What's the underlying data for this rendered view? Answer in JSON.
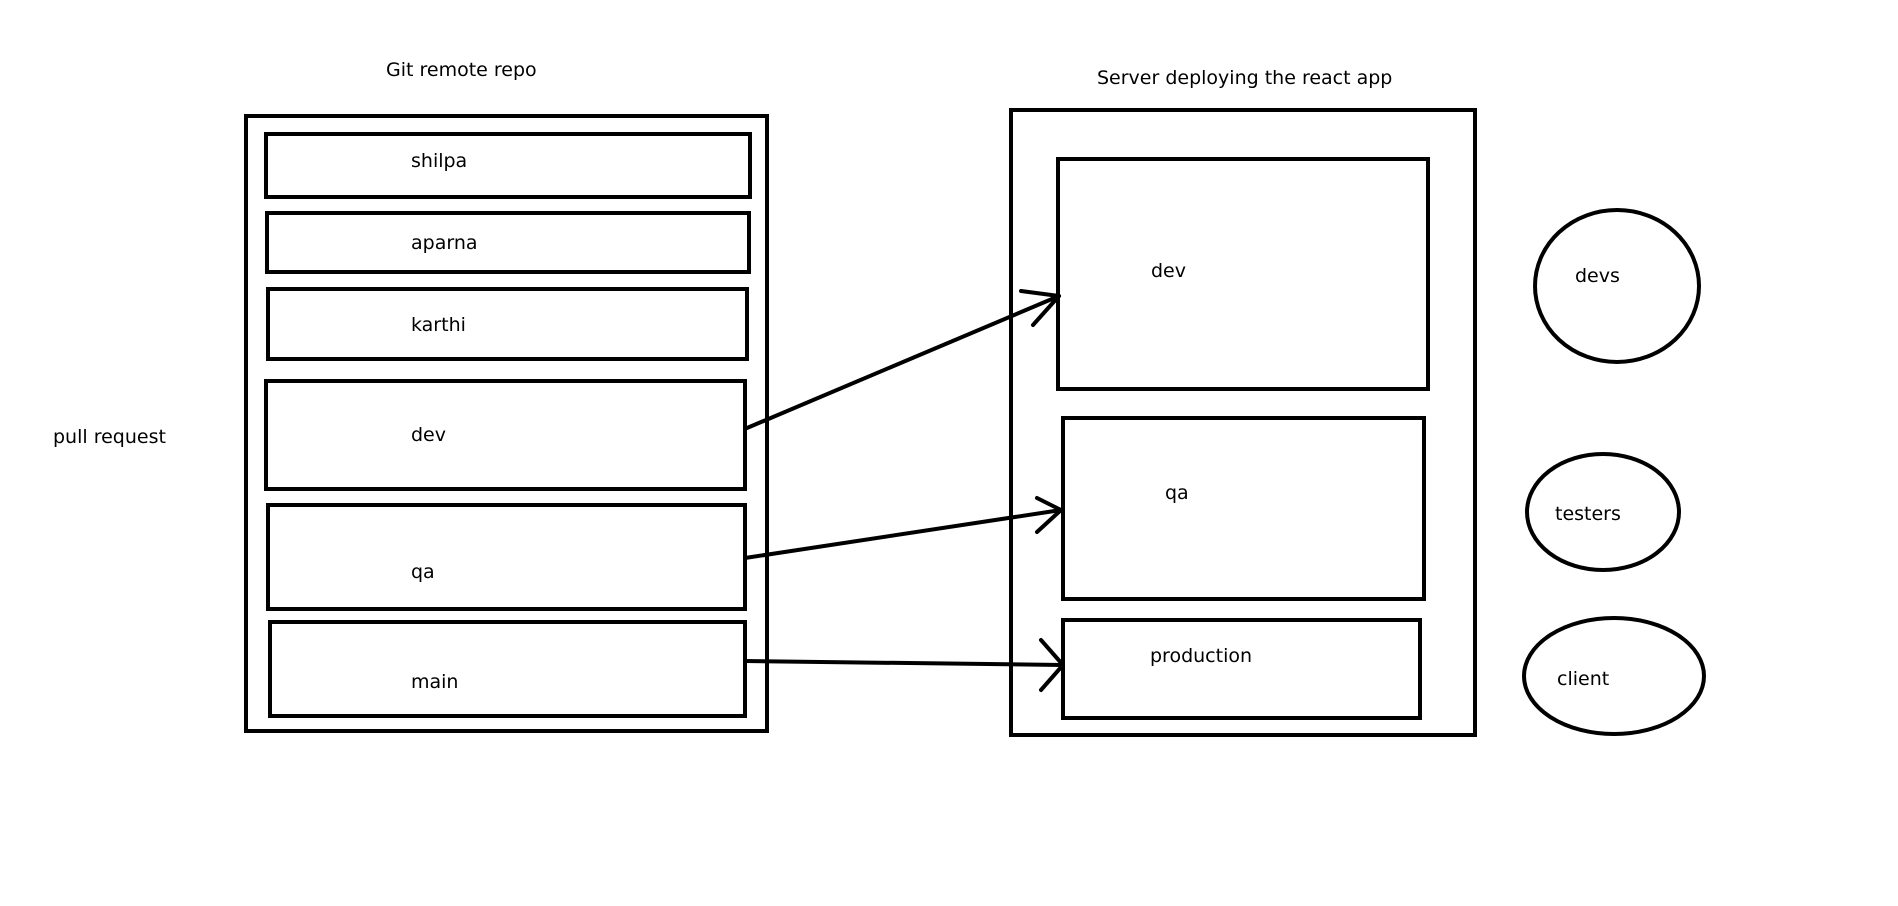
{
  "repo": {
    "title": "Git remote repo",
    "branches": [
      {
        "name": "shilpa"
      },
      {
        "name": "aparna"
      },
      {
        "name": "karthi"
      },
      {
        "name": "dev"
      },
      {
        "name": "qa"
      },
      {
        "name": "main"
      }
    ]
  },
  "side_label": "pull request",
  "server": {
    "title": "Server deploying the react app",
    "environments": [
      {
        "name": "dev"
      },
      {
        "name": "qa"
      },
      {
        "name": "production"
      }
    ]
  },
  "audiences": [
    {
      "name": "devs"
    },
    {
      "name": "testers"
    },
    {
      "name": "client"
    }
  ]
}
